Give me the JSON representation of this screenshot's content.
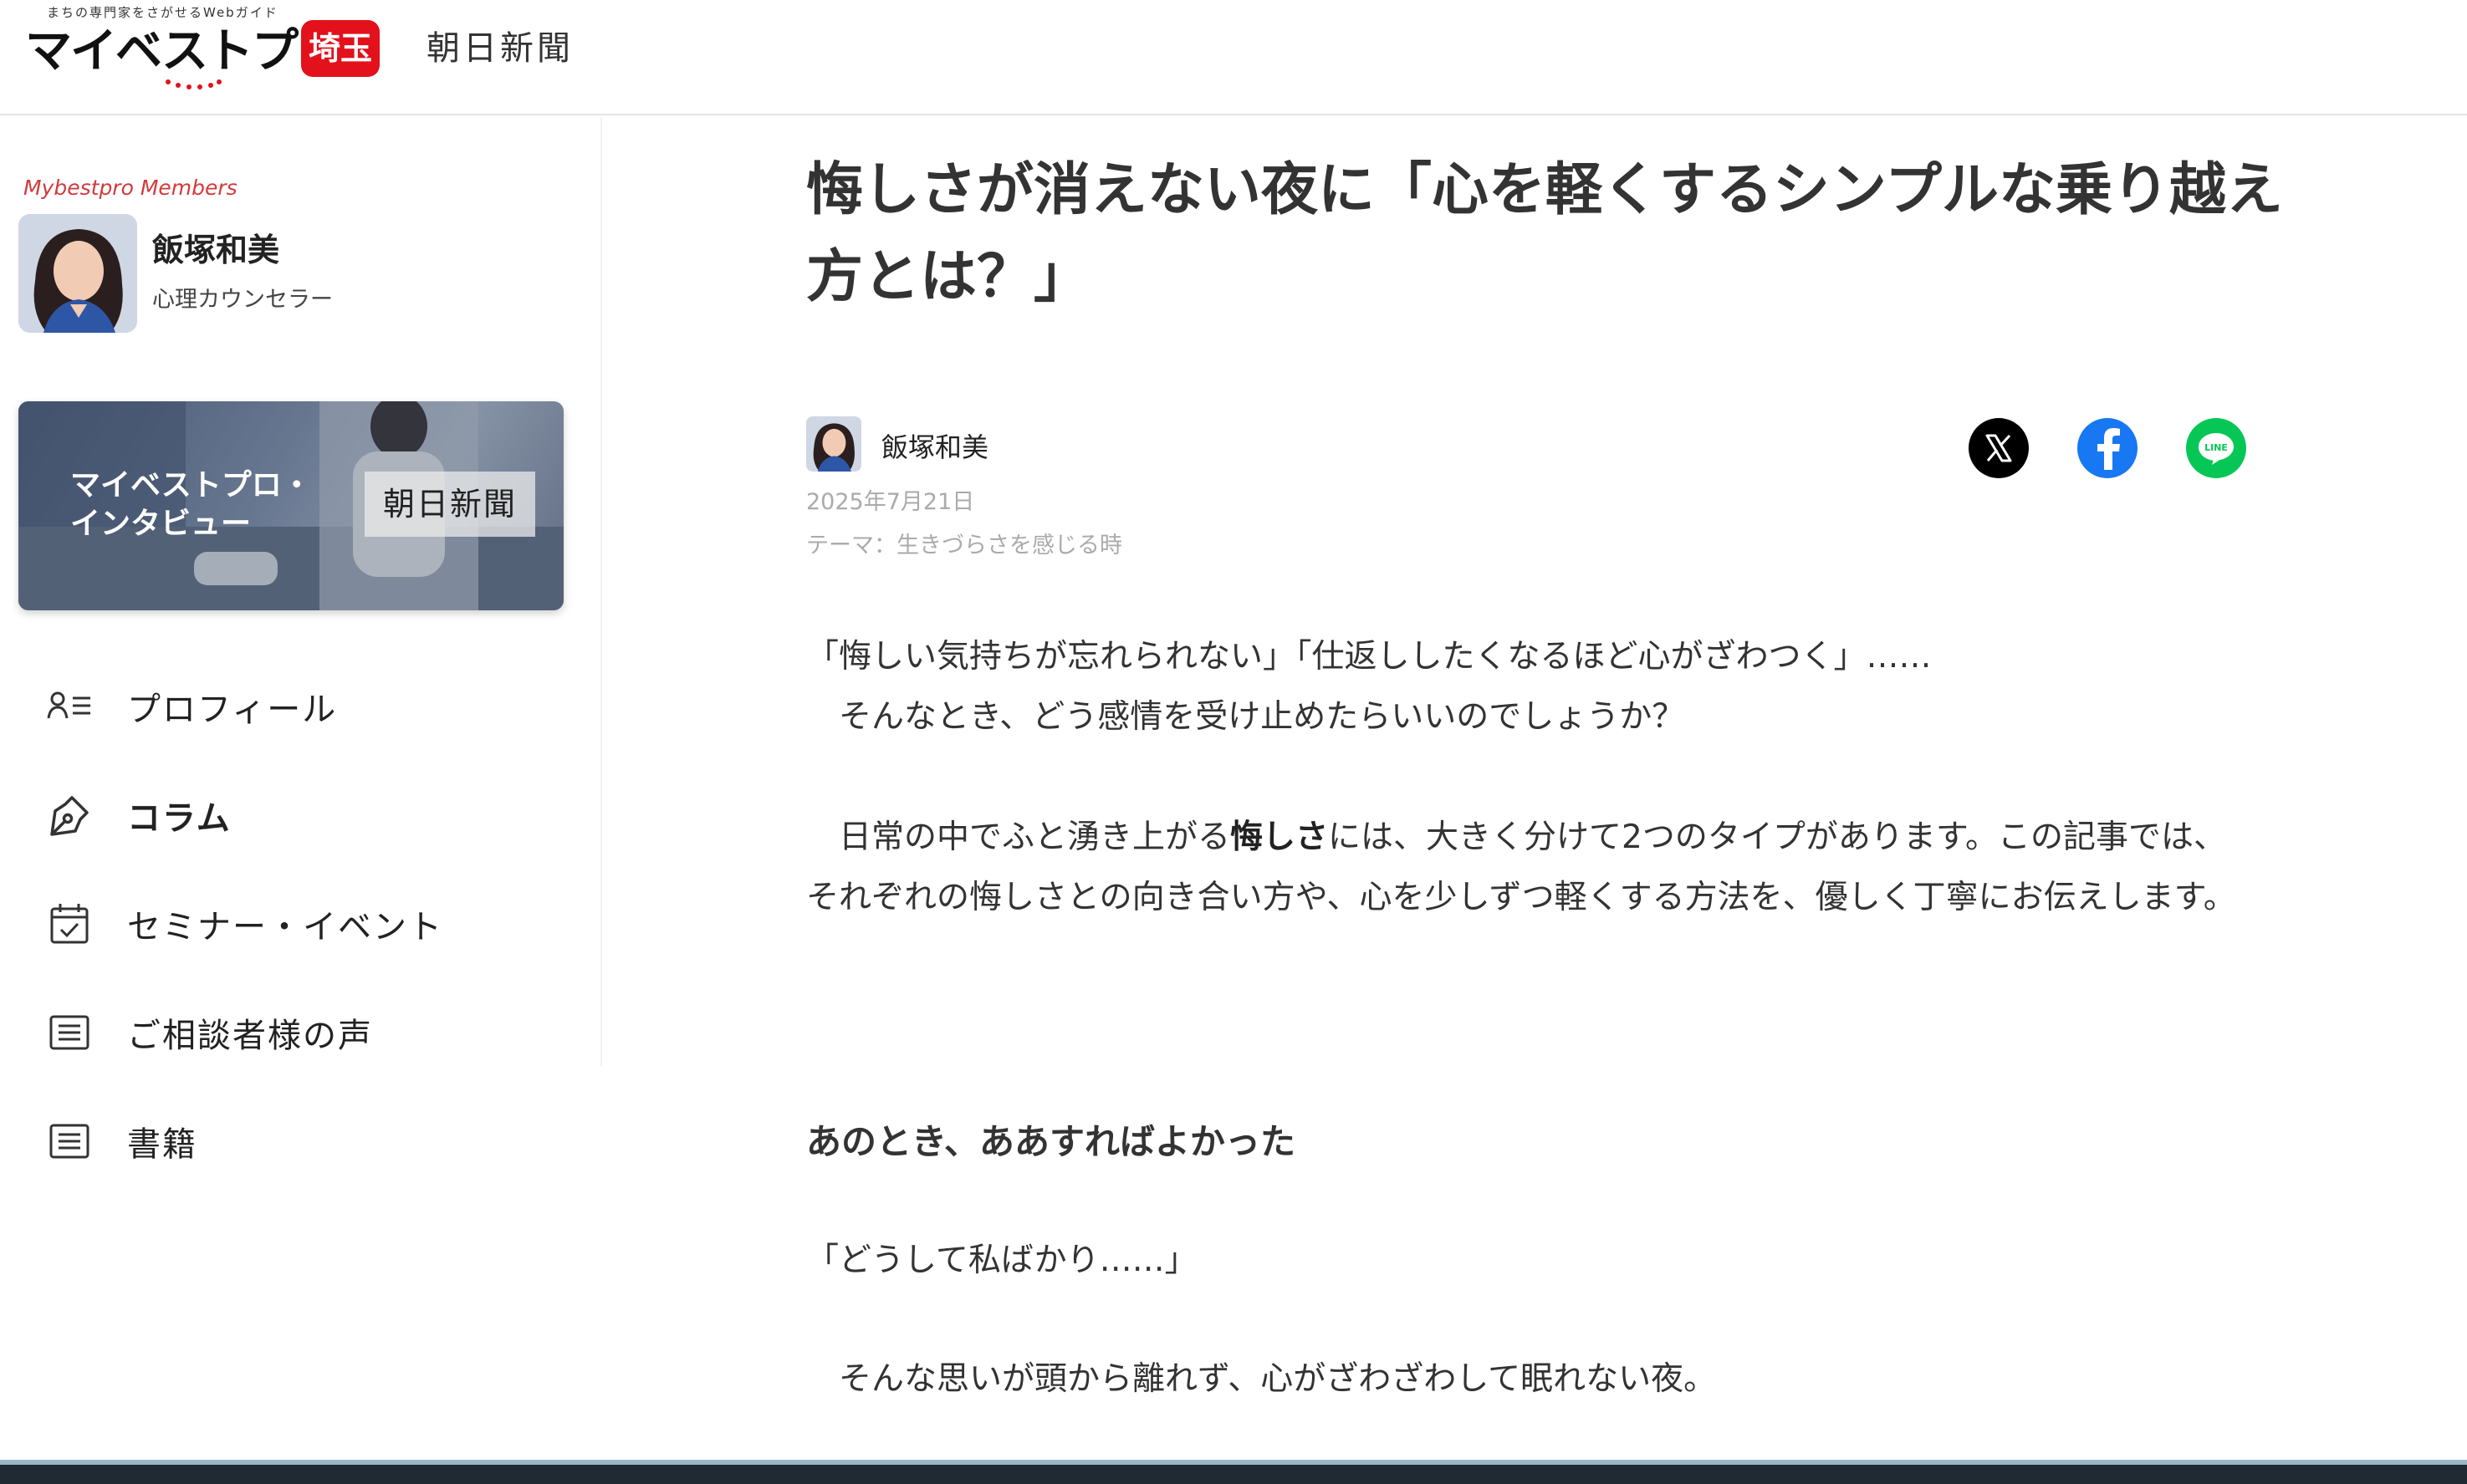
{
  "header": {
    "tagline": "まちの専門家をさがせるWebガイド",
    "logo": "マイベストプロ",
    "region": "埼玉",
    "partner": "朝日新聞"
  },
  "sidebar": {
    "members_label": "Mybestpro Members",
    "profile": {
      "name": "飯塚和美",
      "title": "心理カウンセラー"
    },
    "banner": {
      "title_line1": "マイベストプロ・",
      "title_line2": "インタビュー",
      "partner": "朝日新聞"
    },
    "nav": [
      {
        "label": "プロフィール",
        "icon": "profile-list-icon"
      },
      {
        "label": "コラム",
        "icon": "pen-icon"
      },
      {
        "label": "セミナー・イベント",
        "icon": "calendar-check-icon"
      },
      {
        "label": "ご相談者様の声",
        "icon": "document-lines-icon"
      },
      {
        "label": "書籍",
        "icon": "document-lines-icon"
      }
    ]
  },
  "article": {
    "title": "悔しさが消えない夜に「心を軽くするシンプルな乗り越え方とは？」",
    "author": "飯塚和美",
    "date": "2025年7月21日",
    "theme": "テーマ：生きづらさを感じる時",
    "share": {
      "x": "x-icon",
      "facebook": "facebook-icon",
      "line": "line-icon",
      "line_label": "LINE"
    },
    "p1_line1": "「悔しい気持ちが忘れられない」「仕返ししたくなるほど心がざわつく」……",
    "p1_line2": "　そんなとき、どう感情を受け止めたらいいのでしょうか？",
    "p2_pre": "　日常の中でふと湧き上がる",
    "p2_bold": "悔しさ",
    "p2_post": "には、大きく分けて2つのタイプがあります。この記事では、それぞれの悔しさとの向き合い方や、心を少しずつ軽くする方法を、優しく丁寧にお伝えします。",
    "heading1": "あのとき、ああすればよかった",
    "quote1": "「どうして私ばかり……」",
    "p3": "　そんな思いが頭から離れず、心がざわざわして眠れない夜。"
  },
  "colors": {
    "accent_red": "#e3111b",
    "members_red": "#d23a3a",
    "facebook_blue": "#1877f2",
    "line_green": "#06c755"
  }
}
